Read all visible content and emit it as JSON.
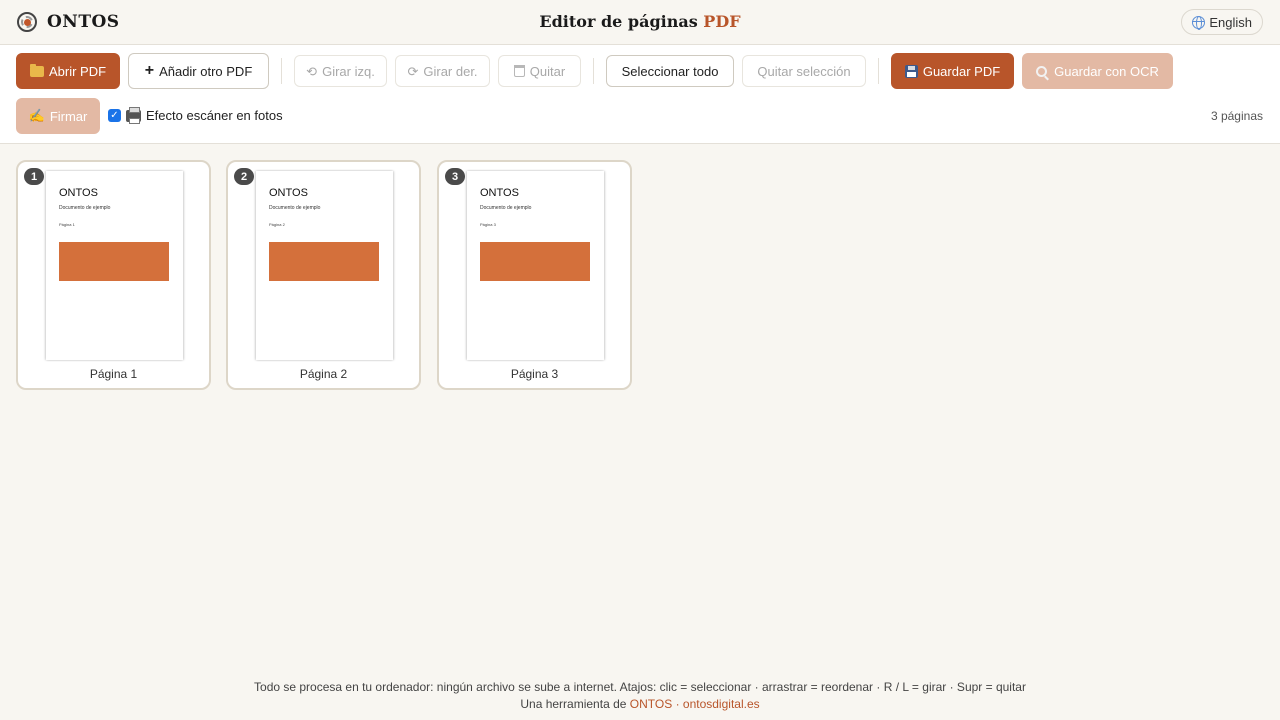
{
  "brand": {
    "name": "ONTOS"
  },
  "header": {
    "title_main": "Editor de páginas",
    "title_accent": "PDF"
  },
  "language": {
    "label": "English"
  },
  "toolbar": {
    "open_pdf": "Abrir PDF",
    "add_pdf": "Añadir otro PDF",
    "rotate_left": "Girar izq.",
    "rotate_right": "Girar der.",
    "remove": "Quitar",
    "select_all": "Seleccionar todo",
    "clear_selection": "Quitar selección",
    "save_pdf": "Guardar PDF",
    "save_ocr": "Guardar con OCR",
    "sign": "Firmar",
    "scanner_effect": "Efecto escáner en fotos",
    "scanner_checked": true,
    "page_count": "3 páginas"
  },
  "pages": [
    {
      "number": "1",
      "label": "Página 1",
      "thumb_title": "ONTOS",
      "thumb_subtitle": "Documento de ejemplo",
      "thumb_page": "Página 1"
    },
    {
      "number": "2",
      "label": "Página 2",
      "thumb_title": "ONTOS",
      "thumb_subtitle": "Documento de ejemplo",
      "thumb_page": "Página 2"
    },
    {
      "number": "3",
      "label": "Página 3",
      "thumb_title": "ONTOS",
      "thumb_subtitle": "Documento de ejemplo",
      "thumb_page": "Página 3"
    }
  ],
  "footer": {
    "info": "Todo se procesa en tu ordenador: ningún archivo se sube a internet. Atajos: clic = seleccionar · arrastrar = reordenar · R / L = girar · Supr = quitar",
    "credit_prefix": "Una herramienta de",
    "credit_brand": "ONTOS",
    "credit_sep": "·",
    "credit_site": "ontosdigital.es"
  },
  "colors": {
    "accent": "#b8552a",
    "accent_disabled": "#e3b9a4",
    "background": "#f8f6f1",
    "thumb_block": "#d4703b"
  }
}
